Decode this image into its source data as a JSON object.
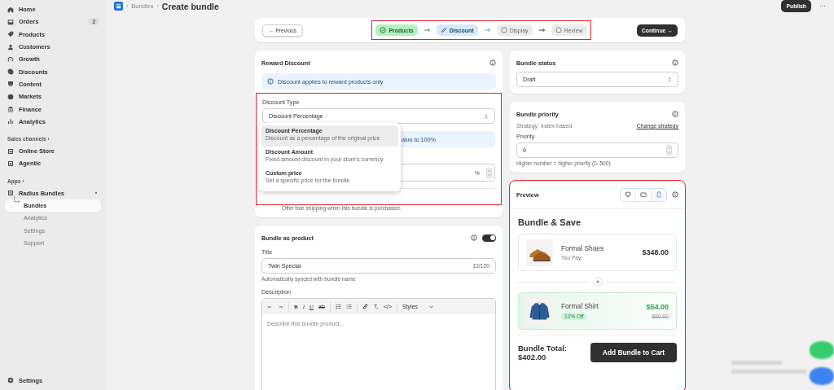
{
  "sidebar": {
    "items": [
      {
        "label": "Home"
      },
      {
        "label": "Orders",
        "badge": "2"
      },
      {
        "label": "Products"
      },
      {
        "label": "Customers"
      },
      {
        "label": "Growth"
      },
      {
        "label": "Discounts"
      },
      {
        "label": "Content"
      },
      {
        "label": "Markets"
      },
      {
        "label": "Finance"
      },
      {
        "label": "Analytics"
      }
    ],
    "sales_channels": {
      "title": "Sales channels ›",
      "items": [
        {
          "label": "Online Store"
        },
        {
          "label": "Agentic"
        }
      ]
    },
    "apps": {
      "title": "Apps ›",
      "app": {
        "label": "Radius Bundles",
        "children": [
          {
            "label": "Bundles",
            "selected": true
          },
          {
            "label": "Analytics",
            "selected": false
          },
          {
            "label": "Settings",
            "selected": false
          },
          {
            "label": "Support",
            "selected": false
          }
        ]
      }
    },
    "footer": {
      "label": "Settings"
    }
  },
  "header": {
    "separators": [
      "›",
      "›"
    ],
    "breadcrumb": "Bundles",
    "title": "Create bundle",
    "publish": "Publish",
    "more": "···"
  },
  "stepper": {
    "previous": "← Previous",
    "continue": "Continue →",
    "steps": [
      {
        "label": "Products",
        "done": true,
        "selected": false
      },
      {
        "label": "Discount",
        "done": false,
        "selected": true
      },
      {
        "label": "Display",
        "done": false,
        "selected": false
      },
      {
        "label": "Review",
        "done": false,
        "selected": false
      }
    ]
  },
  "reward_discount": {
    "title": "Reward Discount",
    "banner": "Discount applies to reward products only",
    "type_label": "Discount Type",
    "type_value": "Discount Percentage",
    "dropdown": [
      {
        "label": "Discount Percentage",
        "description": "Discount as a percentage of the original price",
        "selected": true
      },
      {
        "label": "Discount Amount",
        "description": "Fixed amount discount in your store's currency",
        "selected": false
      },
      {
        "label": "Custom price",
        "description": "Set a specific price for the bundle",
        "selected": false
      }
    ],
    "hidden_banner": "alue to 100%.",
    "value_suffix": "%",
    "shipping_hint": "Offer free shipping when this bundle is purchased."
  },
  "bundle_as_product": {
    "title": "Bundle as product",
    "enabled": true,
    "title_label": "Title",
    "title_value": "Twin Special",
    "counter": "12/120",
    "title_hint": "Automatically synced with bundle name",
    "description_label": "Description",
    "description_placeholder": "Describe this bundle product...",
    "toolbar": [
      {
        "kind": "undo"
      },
      {
        "kind": "redo"
      },
      {
        "kind": "sep"
      },
      {
        "kind": "bold",
        "label": "B"
      },
      {
        "kind": "italic",
        "label": "I"
      },
      {
        "kind": "underline",
        "label": "U"
      },
      {
        "kind": "strike",
        "label": "ab"
      },
      {
        "kind": "sep"
      },
      {
        "kind": "olist"
      },
      {
        "kind": "ulist"
      },
      {
        "kind": "sep"
      },
      {
        "kind": "link"
      },
      {
        "kind": "clear"
      },
      {
        "kind": "code",
        "label": "</>"
      },
      {
        "kind": "sep"
      },
      {
        "kind": "select",
        "label": "Styles"
      }
    ]
  },
  "bundle_status": {
    "title": "Bundle status",
    "value": "Draft"
  },
  "bundle_priority": {
    "title": "Bundle priority",
    "strategy": "Strategy: Index based",
    "change": "Change strategy",
    "label": "Priority",
    "value": "0",
    "hint": "Higher number = higher priority (0–500)"
  },
  "preview": {
    "title": "Preview",
    "devices": [
      {
        "kind": "desktop",
        "selected": false
      },
      {
        "kind": "tablet",
        "selected": false
      },
      {
        "kind": "mobile",
        "selected": true
      }
    ],
    "heading": "Bundle & Save",
    "items": [
      {
        "kind": "base",
        "name": "Formal Shoes",
        "subtitle": "You Pay:",
        "price": "$348.00"
      },
      {
        "kind": "reward",
        "name": "Formal Shirt",
        "badge": "10% Off",
        "price": "$54.00",
        "old_price": "$60.00"
      }
    ],
    "total_label": "Bundle Total:",
    "total": "$402.00",
    "cta": "Add Bundle to Cart"
  }
}
